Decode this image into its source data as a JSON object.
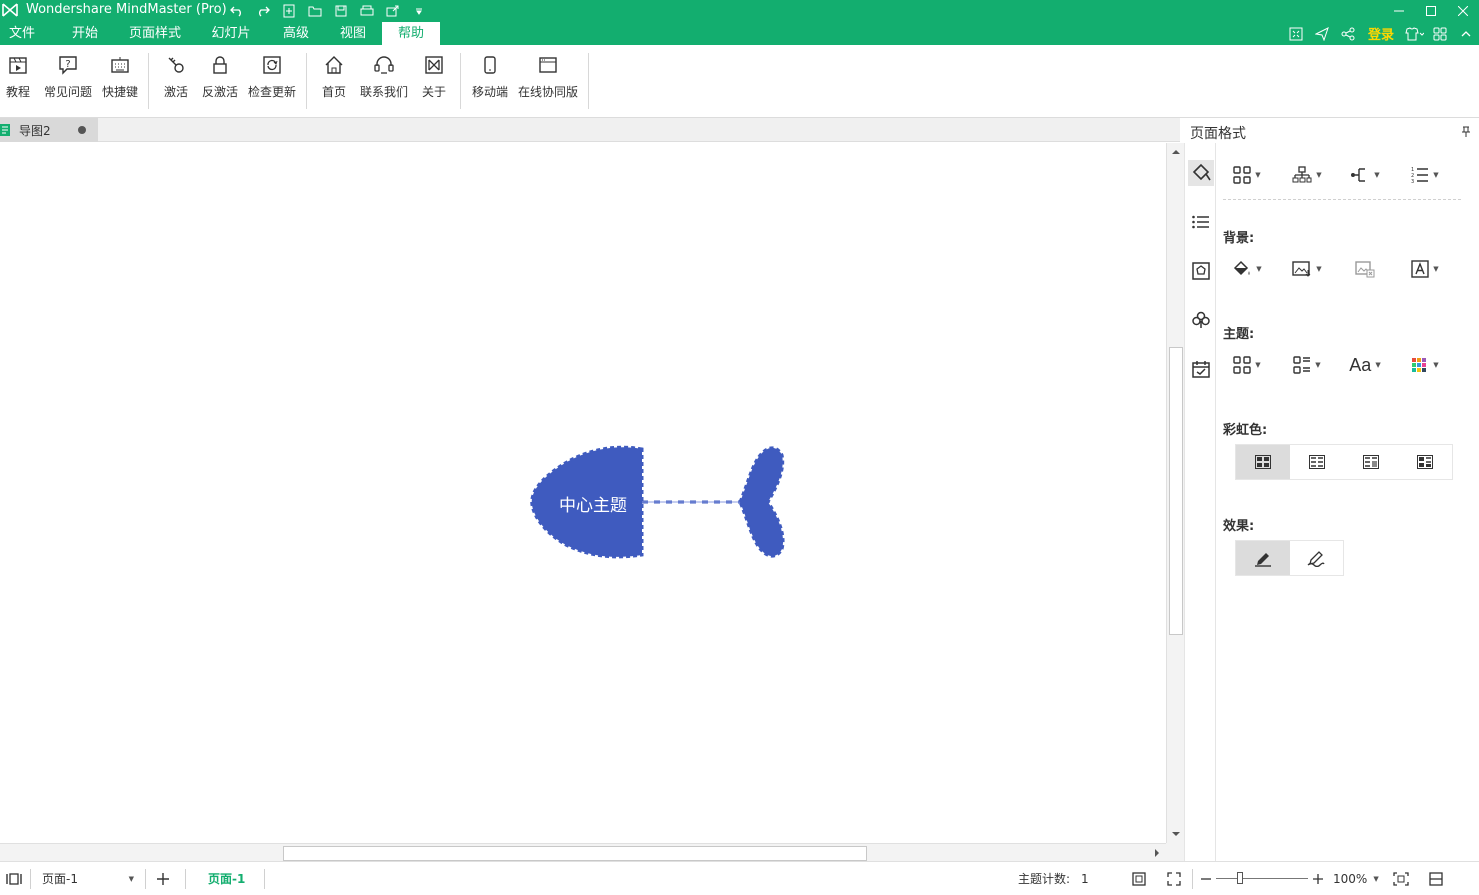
{
  "app": {
    "title": "Wondershare MindMaster (Pro)"
  },
  "menu": {
    "items": [
      {
        "label": "文件"
      },
      {
        "label": "开始"
      },
      {
        "label": "页面样式"
      },
      {
        "label": "幻灯片"
      },
      {
        "label": "高级"
      },
      {
        "label": "视图"
      },
      {
        "label": "帮助"
      }
    ],
    "login": "登录",
    "active": "帮助"
  },
  "ribbon": {
    "buttons": [
      {
        "label": "教程",
        "icon": "video-tutorial-icon"
      },
      {
        "label": "常见问题",
        "icon": "faq-icon"
      },
      {
        "label": "快捷键",
        "icon": "keyboard-icon"
      },
      {
        "label": "激活",
        "icon": "key-icon"
      },
      {
        "label": "反激活",
        "icon": "lock-icon"
      },
      {
        "label": "检查更新",
        "icon": "refresh-icon"
      },
      {
        "label": "首页",
        "icon": "home-icon"
      },
      {
        "label": "联系我们",
        "icon": "headset-icon"
      },
      {
        "label": "关于",
        "icon": "about-icon"
      },
      {
        "label": "移动端",
        "icon": "mobile-icon"
      },
      {
        "label": "在线协同版",
        "icon": "browser-window-icon"
      }
    ]
  },
  "document": {
    "tab_name": "导图2"
  },
  "canvas": {
    "central_topic": "中心主题",
    "topic_color": "#3f5bbf"
  },
  "panel": {
    "title": "页面格式",
    "background_label": "背景:",
    "theme_label": "主题:",
    "rainbow_label": "彩虹色:",
    "effects_label": "效果:"
  },
  "status": {
    "page_select": "页面-1",
    "page_tab": "页面-1",
    "topic_count_label": "主题计数:",
    "topic_count": "1",
    "zoom": "100%"
  },
  "colors": {
    "brand": "#13ae6f",
    "accent_login": "#ffd700"
  }
}
